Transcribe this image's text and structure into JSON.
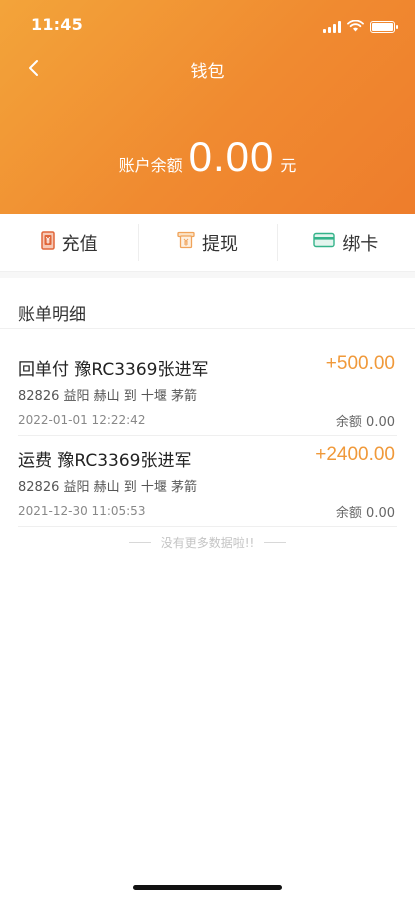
{
  "status_bar": {
    "time": "11:45"
  },
  "nav": {
    "title": "钱包"
  },
  "balance": {
    "label": "账户余额",
    "amount": "0.00",
    "unit": "元"
  },
  "actions": [
    {
      "label": "充值",
      "icon": "recharge-icon",
      "color": "#e0663a"
    },
    {
      "label": "提现",
      "icon": "withdraw-icon",
      "color": "#f0a35a"
    },
    {
      "label": "绑卡",
      "icon": "card-icon",
      "color": "#34b38a"
    }
  ],
  "section": {
    "title": "账单明细"
  },
  "records": [
    {
      "title": "回单付 豫RC3369张进军",
      "amount": "+500.00",
      "route": "82826 益阳 赫山 到 十堰 茅箭",
      "time": "2022-01-01 12:22:42",
      "balance": "余额 0.00"
    },
    {
      "title": "运费 豫RC3369张进军",
      "amount": "+2400.00",
      "route": "82826 益阳 赫山 到 十堰 茅箭",
      "time": "2021-12-30 11:05:53",
      "balance": "余额 0.00"
    }
  ],
  "footer": {
    "no_more": "没有更多数据啦!!"
  },
  "colors": {
    "header_start": "#f3a43a",
    "header_end": "#ee7d2c",
    "amount": "#f0993a"
  }
}
